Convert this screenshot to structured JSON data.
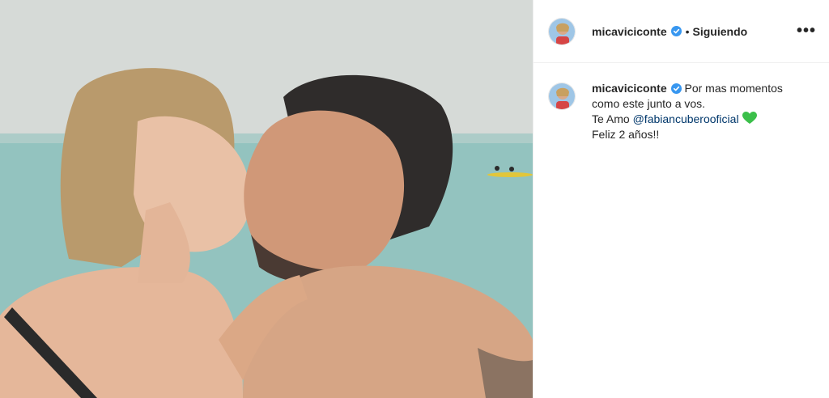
{
  "post": {
    "photo_alt": "",
    "header": {
      "username": "micaviciconte",
      "separator": "•",
      "follow_status": "Siguiendo",
      "more_glyph": "•••"
    },
    "caption": {
      "username": "micaviciconte",
      "line1": "Por mas momentos",
      "line2": "como este junto a vos.",
      "line3_prefix": "Te Amo ",
      "mention": "@fabiancuberooficial",
      "line4": "Feliz 2 años!!",
      "emoji": "green-heart-icon"
    },
    "colors": {
      "verified": "#3897f0",
      "mention": "#00376b",
      "heart": "#3bbf4a"
    }
  }
}
